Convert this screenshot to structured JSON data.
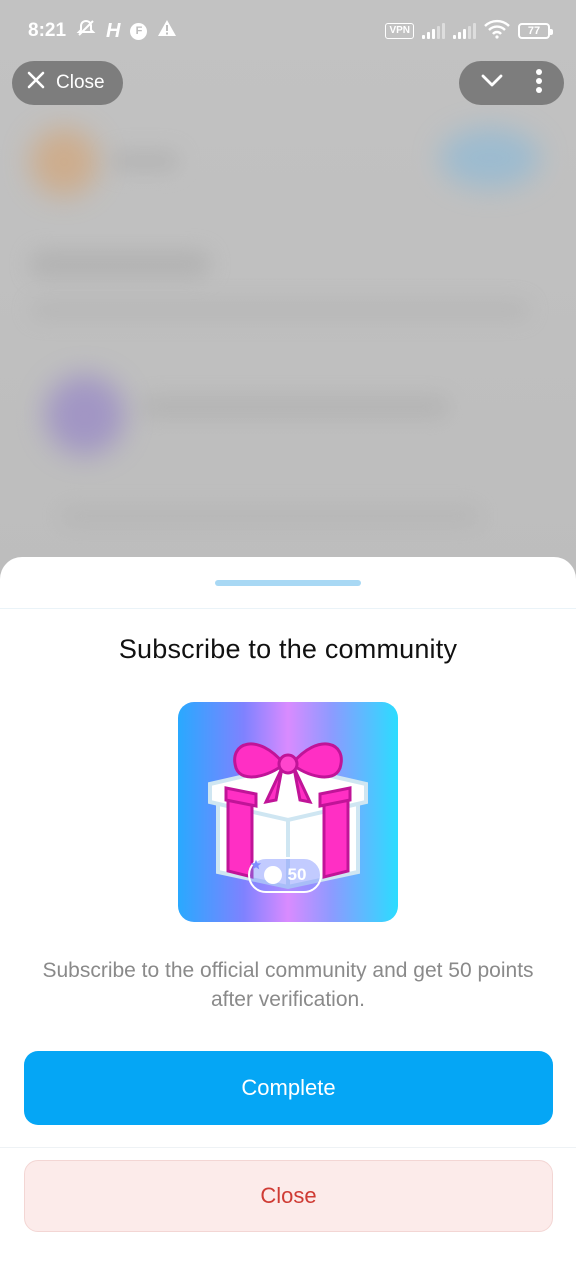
{
  "status_bar": {
    "time": "8:21",
    "vpn_label": "VPN",
    "battery_level": "77",
    "notif_icons": [
      "bell-off-icon",
      "h-icon",
      "f-icon",
      "warning-icon"
    ]
  },
  "top_bar": {
    "close_label": "Close"
  },
  "sheet": {
    "title": "Subscribe to the community",
    "points_value": "50",
    "description": "Subscribe to the official community and get 50 points after verification.",
    "complete_label": "Complete",
    "close_label": "Close"
  },
  "colors": {
    "primary": "#05a6f5",
    "danger_text": "#cf3b34",
    "danger_bg": "#fcebea",
    "handle": "#a8d8f4"
  }
}
